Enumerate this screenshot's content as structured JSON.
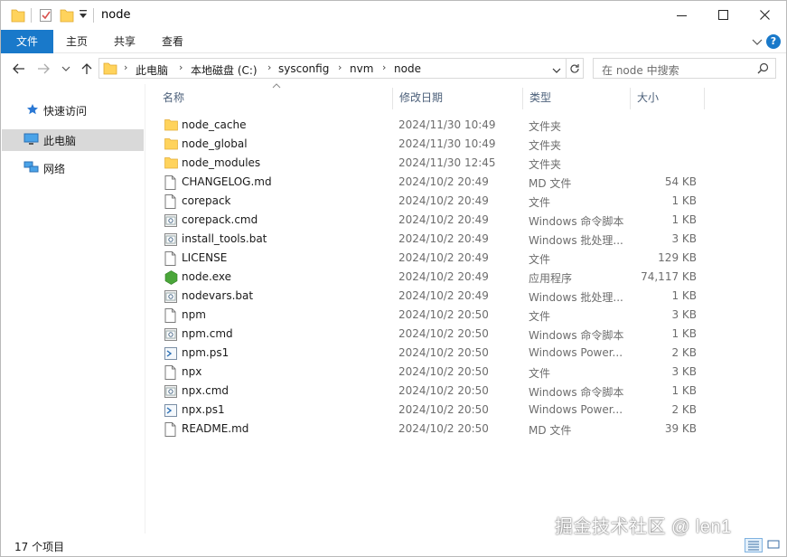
{
  "window": {
    "title": "node",
    "accent": "#1979ca"
  },
  "ribbon": {
    "tabs": [
      "文件",
      "主页",
      "共享",
      "查看"
    ]
  },
  "address": {
    "crumbs": [
      "此电脑",
      "本地磁盘 (C:)",
      "sysconfig",
      "nvm",
      "node"
    ],
    "search_placeholder": "在 node 中搜索"
  },
  "sidebar": {
    "items": [
      {
        "label": "快速访问",
        "icon": "star-icon"
      },
      {
        "label": "此电脑",
        "icon": "monitor-icon",
        "selected": true
      },
      {
        "label": "网络",
        "icon": "network-icon"
      }
    ]
  },
  "columns": {
    "name": "名称",
    "date": "修改日期",
    "type": "类型",
    "size": "大小"
  },
  "files": [
    {
      "name": "node_cache",
      "date": "2024/11/30 10:49",
      "type": "文件夹",
      "size": "",
      "icon": "folder-icon"
    },
    {
      "name": "node_global",
      "date": "2024/11/30 10:49",
      "type": "文件夹",
      "size": "",
      "icon": "folder-icon"
    },
    {
      "name": "node_modules",
      "date": "2024/11/30 12:45",
      "type": "文件夹",
      "size": "",
      "icon": "folder-icon"
    },
    {
      "name": "CHANGELOG.md",
      "date": "2024/10/2 20:49",
      "type": "MD 文件",
      "size": "54 KB",
      "icon": "file-icon"
    },
    {
      "name": "corepack",
      "date": "2024/10/2 20:49",
      "type": "文件",
      "size": "1 KB",
      "icon": "file-icon"
    },
    {
      "name": "corepack.cmd",
      "date": "2024/10/2 20:49",
      "type": "Windows 命令脚本",
      "size": "1 KB",
      "icon": "script-icon"
    },
    {
      "name": "install_tools.bat",
      "date": "2024/10/2 20:49",
      "type": "Windows 批处理...",
      "size": "3 KB",
      "icon": "script-icon"
    },
    {
      "name": "LICENSE",
      "date": "2024/10/2 20:49",
      "type": "文件",
      "size": "129 KB",
      "icon": "file-icon"
    },
    {
      "name": "node.exe",
      "date": "2024/10/2 20:49",
      "type": "应用程序",
      "size": "74,117 KB",
      "icon": "node-hexagon-icon"
    },
    {
      "name": "nodevars.bat",
      "date": "2024/10/2 20:49",
      "type": "Windows 批处理...",
      "size": "1 KB",
      "icon": "script-icon"
    },
    {
      "name": "npm",
      "date": "2024/10/2 20:50",
      "type": "文件",
      "size": "3 KB",
      "icon": "file-icon"
    },
    {
      "name": "npm.cmd",
      "date": "2024/10/2 20:50",
      "type": "Windows 命令脚本",
      "size": "1 KB",
      "icon": "script-icon"
    },
    {
      "name": "npm.ps1",
      "date": "2024/10/2 20:50",
      "type": "Windows Power...",
      "size": "2 KB",
      "icon": "powershell-icon"
    },
    {
      "name": "npx",
      "date": "2024/10/2 20:50",
      "type": "文件",
      "size": "3 KB",
      "icon": "file-icon"
    },
    {
      "name": "npx.cmd",
      "date": "2024/10/2 20:50",
      "type": "Windows 命令脚本",
      "size": "1 KB",
      "icon": "script-icon"
    },
    {
      "name": "npx.ps1",
      "date": "2024/10/2 20:50",
      "type": "Windows Power...",
      "size": "2 KB",
      "icon": "powershell-icon"
    },
    {
      "name": "README.md",
      "date": "2024/10/2 20:50",
      "type": "MD 文件",
      "size": "39 KB",
      "icon": "file-icon"
    }
  ],
  "status": {
    "count_text": "17 个项目"
  },
  "watermark": "掘金技术社区 @ len1"
}
